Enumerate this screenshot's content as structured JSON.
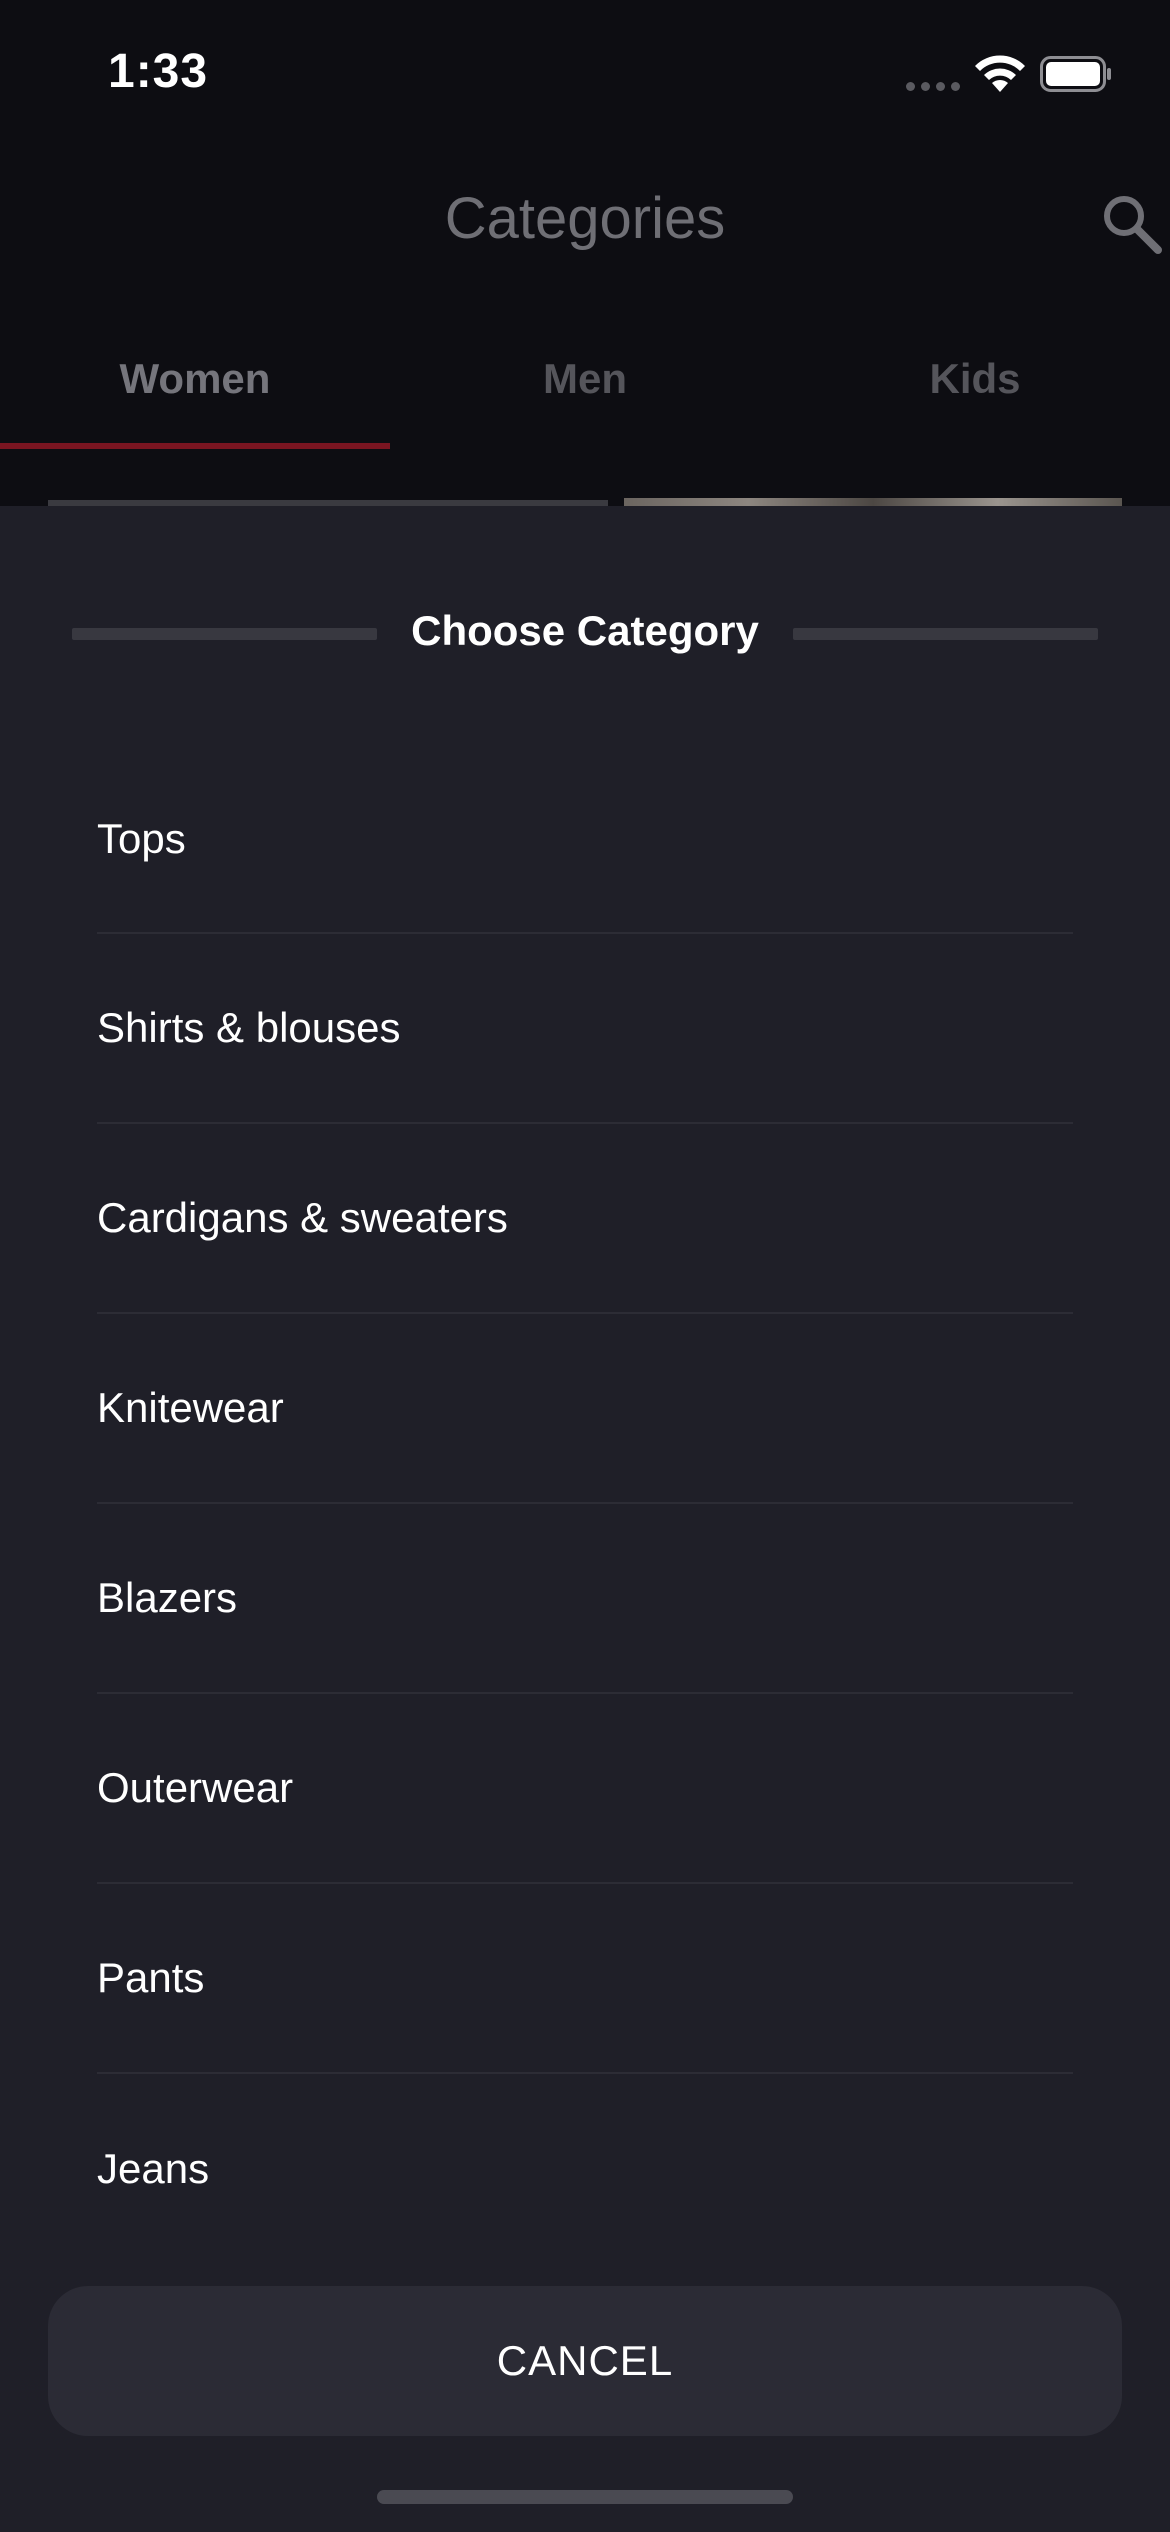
{
  "status_bar": {
    "time": "1:33"
  },
  "header": {
    "title": "Categories",
    "search_icon": "search-icon"
  },
  "tabs": [
    {
      "label": "Women",
      "active": true
    },
    {
      "label": "Men",
      "active": false
    },
    {
      "label": "Kids",
      "active": false
    }
  ],
  "sheet": {
    "title": "Choose Category",
    "items": [
      {
        "label": "Tops"
      },
      {
        "label": "Shirts & blouses"
      },
      {
        "label": "Cardigans & sweaters"
      },
      {
        "label": "Knitewear"
      },
      {
        "label": "Blazers"
      },
      {
        "label": "Outerwear"
      },
      {
        "label": "Pants"
      },
      {
        "label": "Jeans"
      }
    ],
    "cancel_label": "CANCEL"
  },
  "colors": {
    "background": "#0d0d12",
    "sheet": "#1f1f28",
    "accent": "#7a1521",
    "button": "#2b2b35"
  }
}
